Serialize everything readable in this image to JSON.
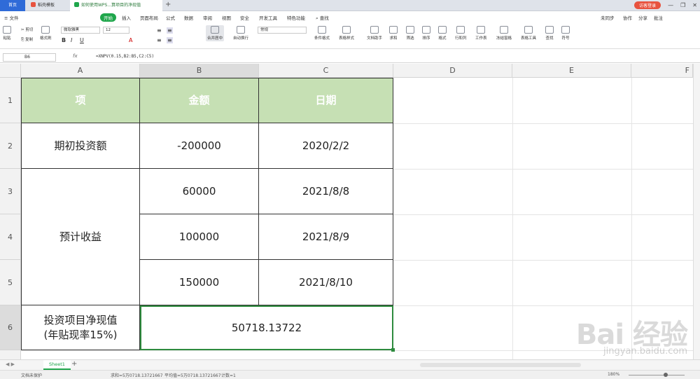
{
  "tabs": {
    "home": "首页",
    "template": "稻壳模板",
    "doc": "如何使用WPS...算项目的净现值"
  },
  "window": {
    "login": "访客登录"
  },
  "menu": {
    "file": "文件",
    "items": [
      "开始",
      "插入",
      "页面布局",
      "公式",
      "数据",
      "审阅",
      "视图",
      "安全",
      "开发工具",
      "特色功能"
    ],
    "search": "查找",
    "sync": "未同步",
    "collab": "协作",
    "share": "分享",
    "annotate": "批注"
  },
  "toolbar": {
    "paste": "粘贴",
    "cut": "剪切",
    "copy": "复制",
    "format_painter": "格式刷",
    "font_name": "微软雅黑",
    "font_size": "12",
    "merge": "合并居中",
    "wrap": "自动换行",
    "number_format": "常规",
    "conditional": "条件格式",
    "table_style": "表格样式",
    "doc_helper": "文档助手",
    "sum": "求和",
    "filter": "筛选",
    "sort": "排序",
    "format": "格式",
    "row_col": "行和列",
    "worksheet": "工作表",
    "freeze": "冻结窗格",
    "table_tools": "表格工具",
    "find": "查找",
    "symbol": "符号"
  },
  "formula_bar": {
    "cell_ref": "B6",
    "fx": "fx",
    "formula": "=XNPV(0.15,B2:B5,C2:C5)"
  },
  "columns": [
    "A",
    "B",
    "C",
    "D",
    "E",
    "F"
  ],
  "rows": [
    "1",
    "2",
    "3",
    "4",
    "5",
    "6"
  ],
  "table": {
    "header": {
      "a": "项",
      "b": "金额",
      "c": "日期"
    },
    "initial_label": "期初投资额",
    "income_label": "预计收益",
    "amounts": [
      "-200000",
      "60000",
      "100000",
      "150000"
    ],
    "dates": [
      "2020/2/2",
      "2021/8/8",
      "2021/8/9",
      "2021/8/10"
    ],
    "npv_label_1": "投资项目净现值",
    "npv_label_2": "(年贴现率15%)",
    "npv_value": "50718.13722"
  },
  "sheet_tab": "Sheet1",
  "status": {
    "protect": "文档未保护",
    "sum": "求和=5万0718.13721667",
    "avg": "平均值=5万0718.13721667",
    "count": "计数=1",
    "zoom": "180%"
  },
  "watermark": {
    "brand": "Bai 经验",
    "url": "jingyan.baidu.com"
  },
  "colors": {
    "header_fill": "#c6e0b4",
    "selection": "#2e8b3e",
    "accent": "#1fa64b"
  }
}
